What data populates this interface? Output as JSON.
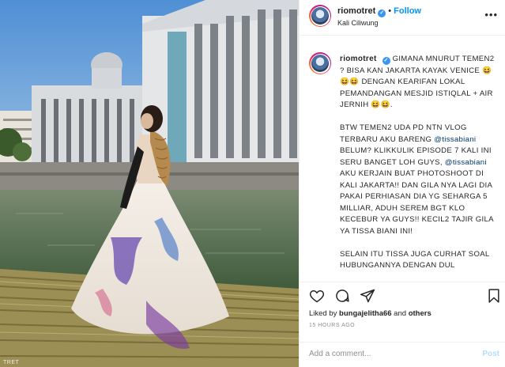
{
  "photo": {
    "alt_credit": "TRET",
    "colors": {
      "sky": "#5f98d6",
      "water": "#5b7a55",
      "building": "#dfe3e6",
      "dress": "#f2ece4"
    }
  },
  "post": {
    "username": "riomotret",
    "verified": true,
    "follow_label": "Follow",
    "location": "Kali Ciliwung",
    "more_icon": "more-horizontal-icon"
  },
  "caption": {
    "username": "riomotret",
    "paragraph1": "GIMANA MNURUT TEMEN2 ? BISA KAN JAKARTA KAYAK VENICE 😆😆😆 DENGAN KEARIFAN LOKAL PEMANDANGAN MESJID ISTIQLAL + AIR JERNIH 😆😆.",
    "p2_before": "BTW TEMEN2 UDA PD NTN VLOG TERBARU AKU BARENG ",
    "mention1": "@tissabiani",
    "p2_middle": " BELUM? KLIKKULIK EPISODE 7 KALI INI SERU BANGET LOH GUYS, ",
    "mention2": "@tissabiani",
    "p2_after": " AKU KERJAIN BUAT PHOTOSHOOT DI KALI JAKARTA!! DAN GILA NYA LAGI DIA PAKAI PERHIASAN DIA YG SEHARGA 5 MILLIAR, ADUH SEREM BGT KLO KECEBUR YA GUYS!! KECIL2 TAJIR GILA YA TISSA BIANI INI!",
    "paragraph3": "SELAIN ITU TISSA JUGA CURHAT SOAL HUBUNGANNYA DENGAN DUL"
  },
  "actions": {
    "like_icon": "heart-icon",
    "comment_icon": "comment-icon",
    "share_icon": "share-icon",
    "save_icon": "bookmark-icon"
  },
  "likes": {
    "prefix": "Liked by ",
    "user": "bungajelitha66",
    "suffix": " and ",
    "others": "others"
  },
  "timestamp": "15 HOURS AGO",
  "comment_box": {
    "placeholder": "Add a comment...",
    "post_label": "Post"
  }
}
